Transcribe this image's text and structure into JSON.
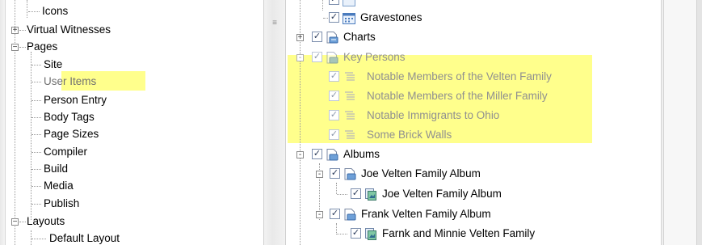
{
  "left_tree": {
    "items": [
      {
        "label": "Icons"
      },
      {
        "label": "Virtual Witnesses"
      },
      {
        "label": "Pages"
      },
      {
        "label": "Site"
      },
      {
        "label": "User Items"
      },
      {
        "label": "Person Entry"
      },
      {
        "label": "Body Tags"
      },
      {
        "label": "Page Sizes"
      },
      {
        "label": "Compiler"
      },
      {
        "label": "Build"
      },
      {
        "label": "Media"
      },
      {
        "label": "Publish"
      },
      {
        "label": "Layouts"
      },
      {
        "label": "Default Layout"
      }
    ],
    "highlighted_item": "User Items"
  },
  "right_tree": {
    "items": [
      {
        "label": "Gravestones",
        "checked": true
      },
      {
        "label": "Charts",
        "checked": true,
        "expander": "+"
      },
      {
        "label": "Key Persons",
        "checked": true,
        "expander": "-"
      },
      {
        "label": "Notable Members of the Velten Family",
        "checked": true
      },
      {
        "label": "Notable Members of the Miller Family",
        "checked": true
      },
      {
        "label": "Notable Immigrants to Ohio",
        "checked": true
      },
      {
        "label": "Some Brick Walls",
        "checked": true
      },
      {
        "label": "Albums",
        "checked": true,
        "expander": "-"
      },
      {
        "label": "Joe Velten Family Album",
        "checked": true,
        "expander": "-"
      },
      {
        "label": "Joe Velten Family Album",
        "checked": true
      },
      {
        "label": "Frank Velten Family Album",
        "checked": true,
        "expander": "-"
      },
      {
        "label": "Farnk and Minnie Velten Family",
        "checked": true
      }
    ],
    "check_mark": "✓"
  },
  "colors": {
    "highlight": "#ffff8c",
    "tree_line": "#9a9a9a",
    "dim_text": "#909090"
  }
}
